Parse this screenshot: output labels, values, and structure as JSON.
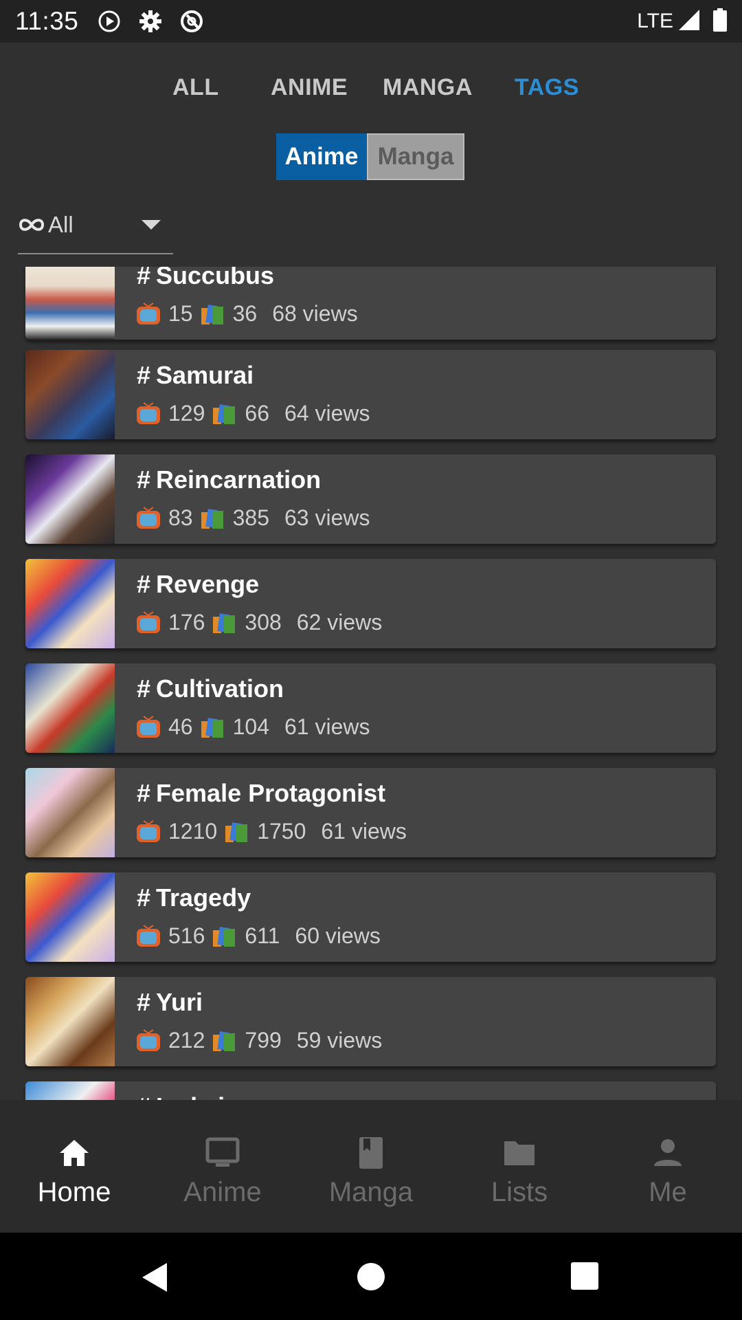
{
  "status_bar": {
    "time": "11:35",
    "network": "LTE"
  },
  "tabs": [
    {
      "label": "ALL",
      "active": false
    },
    {
      "label": "ANIME",
      "active": false
    },
    {
      "label": "MANGA",
      "active": false
    },
    {
      "label": "TAGS",
      "active": true
    }
  ],
  "toggle": {
    "selected": "Anime",
    "other": "Manga"
  },
  "filter": {
    "value": "All",
    "icon": "infinity-icon"
  },
  "tags": [
    {
      "name": "Succubus",
      "anime": "15",
      "manga": "36",
      "views": "68 views"
    },
    {
      "name": "Samurai",
      "anime": "129",
      "manga": "66",
      "views": "64 views"
    },
    {
      "name": "Reincarnation",
      "anime": "83",
      "manga": "385",
      "views": "63 views"
    },
    {
      "name": "Revenge",
      "anime": "176",
      "manga": "308",
      "views": "62 views"
    },
    {
      "name": "Cultivation",
      "anime": "46",
      "manga": "104",
      "views": "61 views"
    },
    {
      "name": "Female Protagonist",
      "anime": "1210",
      "manga": "1750",
      "views": "61 views"
    },
    {
      "name": "Tragedy",
      "anime": "516",
      "manga": "611",
      "views": "60 views"
    },
    {
      "name": "Yuri",
      "anime": "212",
      "manga": "799",
      "views": "59 views"
    },
    {
      "name": "Isekai",
      "anime": "",
      "manga": "",
      "views": ""
    }
  ],
  "bottom_nav": [
    {
      "label": "Home",
      "icon": "home-icon",
      "active": true
    },
    {
      "label": "Anime",
      "icon": "monitor-icon",
      "active": false
    },
    {
      "label": "Manga",
      "icon": "book-icon",
      "active": false
    },
    {
      "label": "Lists",
      "icon": "folder-icon",
      "active": false
    },
    {
      "label": "Me",
      "icon": "person-icon",
      "active": false
    }
  ],
  "colors": {
    "background": "#303030",
    "card": "#444444",
    "accent": "#2b8fd6",
    "toggle_on": "#0a5fa3",
    "toggle_off": "#9e9e9e"
  }
}
